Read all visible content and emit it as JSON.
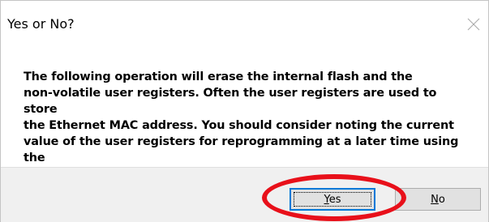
{
  "dialog": {
    "title": "Yes or No?",
    "message": "The following operation will erase the internal flash and the\nnon-volatile user registers.  Often the user registers are used to store\nthe Ethernet MAC address. You should consider noting the current\nvalue of the user registers for reprogramming at a later time using the\nthe User Register Programming utility.  Would you like to continue?",
    "buttons": {
      "yes_label": "Yes",
      "no_label": "No"
    }
  },
  "colors": {
    "annotation_ring": "#e8101a",
    "footer_bg": "#f0f0f0",
    "button_bg": "#e1e1e1",
    "default_button_border": "#0078d7"
  },
  "icons": {
    "close": "close-icon"
  },
  "annotation": {
    "target": "yes-button"
  }
}
